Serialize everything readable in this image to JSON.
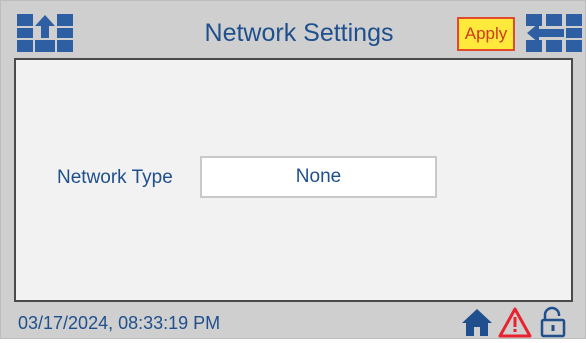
{
  "header": {
    "title": "Network Settings",
    "apply_label": "Apply",
    "left_icon": "nav-up-icon",
    "right_icon": "nav-back-icon"
  },
  "main": {
    "network_type": {
      "label": "Network Type",
      "value": "None"
    }
  },
  "footer": {
    "datetime": "03/17/2024, 08:33:19 PM",
    "icons": [
      "home-icon",
      "warning-icon",
      "unlock-icon"
    ]
  },
  "colors": {
    "background": "#cfcfcf",
    "text_blue": "#1f4f8c",
    "icon_blue": "#2e5fa3",
    "apply_fill": "#ffe93a",
    "apply_border": "#e14b2a",
    "alarm_red": "#e8232f"
  }
}
